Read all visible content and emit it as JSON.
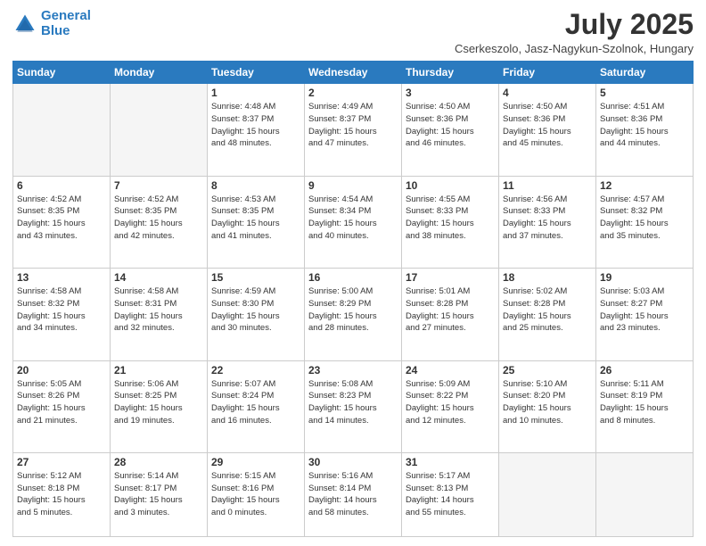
{
  "header": {
    "logo_line1": "General",
    "logo_line2": "Blue",
    "month": "July 2025",
    "location": "Cserkeszolo, Jasz-Nagykun-Szolnok, Hungary"
  },
  "weekdays": [
    "Sunday",
    "Monday",
    "Tuesday",
    "Wednesday",
    "Thursday",
    "Friday",
    "Saturday"
  ],
  "weeks": [
    [
      {
        "day": "",
        "info": ""
      },
      {
        "day": "",
        "info": ""
      },
      {
        "day": "1",
        "info": "Sunrise: 4:48 AM\nSunset: 8:37 PM\nDaylight: 15 hours\nand 48 minutes."
      },
      {
        "day": "2",
        "info": "Sunrise: 4:49 AM\nSunset: 8:37 PM\nDaylight: 15 hours\nand 47 minutes."
      },
      {
        "day": "3",
        "info": "Sunrise: 4:50 AM\nSunset: 8:36 PM\nDaylight: 15 hours\nand 46 minutes."
      },
      {
        "day": "4",
        "info": "Sunrise: 4:50 AM\nSunset: 8:36 PM\nDaylight: 15 hours\nand 45 minutes."
      },
      {
        "day": "5",
        "info": "Sunrise: 4:51 AM\nSunset: 8:36 PM\nDaylight: 15 hours\nand 44 minutes."
      }
    ],
    [
      {
        "day": "6",
        "info": "Sunrise: 4:52 AM\nSunset: 8:35 PM\nDaylight: 15 hours\nand 43 minutes."
      },
      {
        "day": "7",
        "info": "Sunrise: 4:52 AM\nSunset: 8:35 PM\nDaylight: 15 hours\nand 42 minutes."
      },
      {
        "day": "8",
        "info": "Sunrise: 4:53 AM\nSunset: 8:35 PM\nDaylight: 15 hours\nand 41 minutes."
      },
      {
        "day": "9",
        "info": "Sunrise: 4:54 AM\nSunset: 8:34 PM\nDaylight: 15 hours\nand 40 minutes."
      },
      {
        "day": "10",
        "info": "Sunrise: 4:55 AM\nSunset: 8:33 PM\nDaylight: 15 hours\nand 38 minutes."
      },
      {
        "day": "11",
        "info": "Sunrise: 4:56 AM\nSunset: 8:33 PM\nDaylight: 15 hours\nand 37 minutes."
      },
      {
        "day": "12",
        "info": "Sunrise: 4:57 AM\nSunset: 8:32 PM\nDaylight: 15 hours\nand 35 minutes."
      }
    ],
    [
      {
        "day": "13",
        "info": "Sunrise: 4:58 AM\nSunset: 8:32 PM\nDaylight: 15 hours\nand 34 minutes."
      },
      {
        "day": "14",
        "info": "Sunrise: 4:58 AM\nSunset: 8:31 PM\nDaylight: 15 hours\nand 32 minutes."
      },
      {
        "day": "15",
        "info": "Sunrise: 4:59 AM\nSunset: 8:30 PM\nDaylight: 15 hours\nand 30 minutes."
      },
      {
        "day": "16",
        "info": "Sunrise: 5:00 AM\nSunset: 8:29 PM\nDaylight: 15 hours\nand 28 minutes."
      },
      {
        "day": "17",
        "info": "Sunrise: 5:01 AM\nSunset: 8:28 PM\nDaylight: 15 hours\nand 27 minutes."
      },
      {
        "day": "18",
        "info": "Sunrise: 5:02 AM\nSunset: 8:28 PM\nDaylight: 15 hours\nand 25 minutes."
      },
      {
        "day": "19",
        "info": "Sunrise: 5:03 AM\nSunset: 8:27 PM\nDaylight: 15 hours\nand 23 minutes."
      }
    ],
    [
      {
        "day": "20",
        "info": "Sunrise: 5:05 AM\nSunset: 8:26 PM\nDaylight: 15 hours\nand 21 minutes."
      },
      {
        "day": "21",
        "info": "Sunrise: 5:06 AM\nSunset: 8:25 PM\nDaylight: 15 hours\nand 19 minutes."
      },
      {
        "day": "22",
        "info": "Sunrise: 5:07 AM\nSunset: 8:24 PM\nDaylight: 15 hours\nand 16 minutes."
      },
      {
        "day": "23",
        "info": "Sunrise: 5:08 AM\nSunset: 8:23 PM\nDaylight: 15 hours\nand 14 minutes."
      },
      {
        "day": "24",
        "info": "Sunrise: 5:09 AM\nSunset: 8:22 PM\nDaylight: 15 hours\nand 12 minutes."
      },
      {
        "day": "25",
        "info": "Sunrise: 5:10 AM\nSunset: 8:20 PM\nDaylight: 15 hours\nand 10 minutes."
      },
      {
        "day": "26",
        "info": "Sunrise: 5:11 AM\nSunset: 8:19 PM\nDaylight: 15 hours\nand 8 minutes."
      }
    ],
    [
      {
        "day": "27",
        "info": "Sunrise: 5:12 AM\nSunset: 8:18 PM\nDaylight: 15 hours\nand 5 minutes."
      },
      {
        "day": "28",
        "info": "Sunrise: 5:14 AM\nSunset: 8:17 PM\nDaylight: 15 hours\nand 3 minutes."
      },
      {
        "day": "29",
        "info": "Sunrise: 5:15 AM\nSunset: 8:16 PM\nDaylight: 15 hours\nand 0 minutes."
      },
      {
        "day": "30",
        "info": "Sunrise: 5:16 AM\nSunset: 8:14 PM\nDaylight: 14 hours\nand 58 minutes."
      },
      {
        "day": "31",
        "info": "Sunrise: 5:17 AM\nSunset: 8:13 PM\nDaylight: 14 hours\nand 55 minutes."
      },
      {
        "day": "",
        "info": ""
      },
      {
        "day": "",
        "info": ""
      }
    ]
  ]
}
